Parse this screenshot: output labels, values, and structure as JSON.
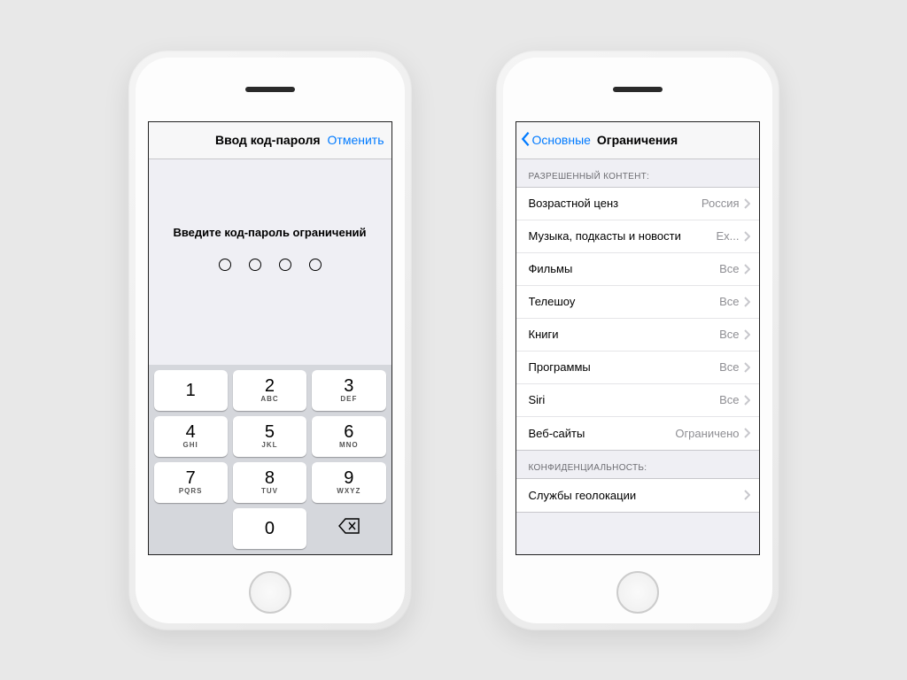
{
  "left": {
    "nav": {
      "title": "Ввод код-пароля",
      "cancel": "Отменить"
    },
    "prompt": "Введите код-пароль ограничений",
    "keypad": [
      {
        "digit": "1",
        "letters": ""
      },
      {
        "digit": "2",
        "letters": "ABC"
      },
      {
        "digit": "3",
        "letters": "DEF"
      },
      {
        "digit": "4",
        "letters": "GHI"
      },
      {
        "digit": "5",
        "letters": "JKL"
      },
      {
        "digit": "6",
        "letters": "MNO"
      },
      {
        "digit": "7",
        "letters": "PQRS"
      },
      {
        "digit": "8",
        "letters": "TUV"
      },
      {
        "digit": "9",
        "letters": "WXYZ"
      },
      {
        "digit": "0",
        "letters": ""
      }
    ]
  },
  "right": {
    "nav": {
      "back": "Основные",
      "title": "Ограничения"
    },
    "sections": {
      "content": {
        "header": "РАЗРЕШЕННЫЙ КОНТЕНТ:",
        "rows": [
          {
            "label": "Возрастной ценз",
            "value": "Россия"
          },
          {
            "label": "Музыка, подкасты и новости",
            "value": "Ex..."
          },
          {
            "label": "Фильмы",
            "value": "Все"
          },
          {
            "label": "Телешоу",
            "value": "Все"
          },
          {
            "label": "Книги",
            "value": "Все"
          },
          {
            "label": "Программы",
            "value": "Все"
          },
          {
            "label": "Siri",
            "value": "Все"
          },
          {
            "label": "Веб-сайты",
            "value": "Ограничено"
          }
        ]
      },
      "privacy": {
        "header": "КОНФИДЕНЦИАЛЬНОСТЬ:",
        "rows": [
          {
            "label": "Службы геолокации",
            "value": ""
          }
        ]
      }
    }
  }
}
